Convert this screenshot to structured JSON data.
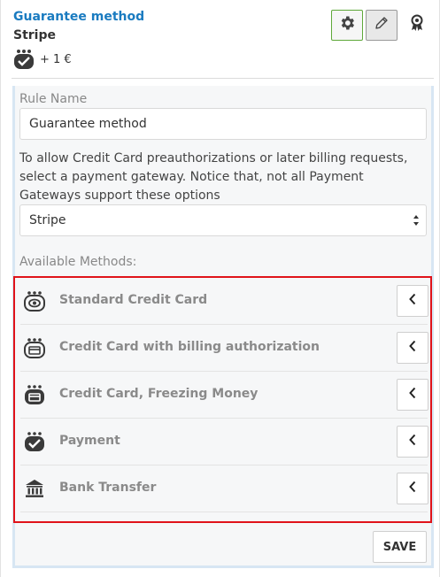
{
  "header": {
    "title": "Guarantee method",
    "subtitle": "Stripe",
    "price": "+ 1 €",
    "colors": {
      "title": "#1a7bc0",
      "gear_border": "#5fa83a"
    }
  },
  "form": {
    "rule_name_label": "Rule Name",
    "rule_name_value": "Guarantee method",
    "description": "To allow Credit Card preauthorizations or later billing requests, select a payment gateway. Notice that, not all Payment Gateways support these options",
    "gateway_selected": "Stripe",
    "available_methods_label": "Available Methods:",
    "methods": [
      {
        "label": "Standard Credit Card",
        "icon": "credit-card-eye-icon"
      },
      {
        "label": "Credit Card with billing authorization",
        "icon": "credit-card-auth-icon"
      },
      {
        "label": "Credit Card, Freezing Money",
        "icon": "credit-card-freeze-icon"
      },
      {
        "label": "Payment",
        "icon": "payment-check-icon"
      },
      {
        "label": "Bank Transfer",
        "icon": "bank-icon"
      }
    ],
    "highlight_color": "#e0131a",
    "save_label": "SAVE"
  }
}
